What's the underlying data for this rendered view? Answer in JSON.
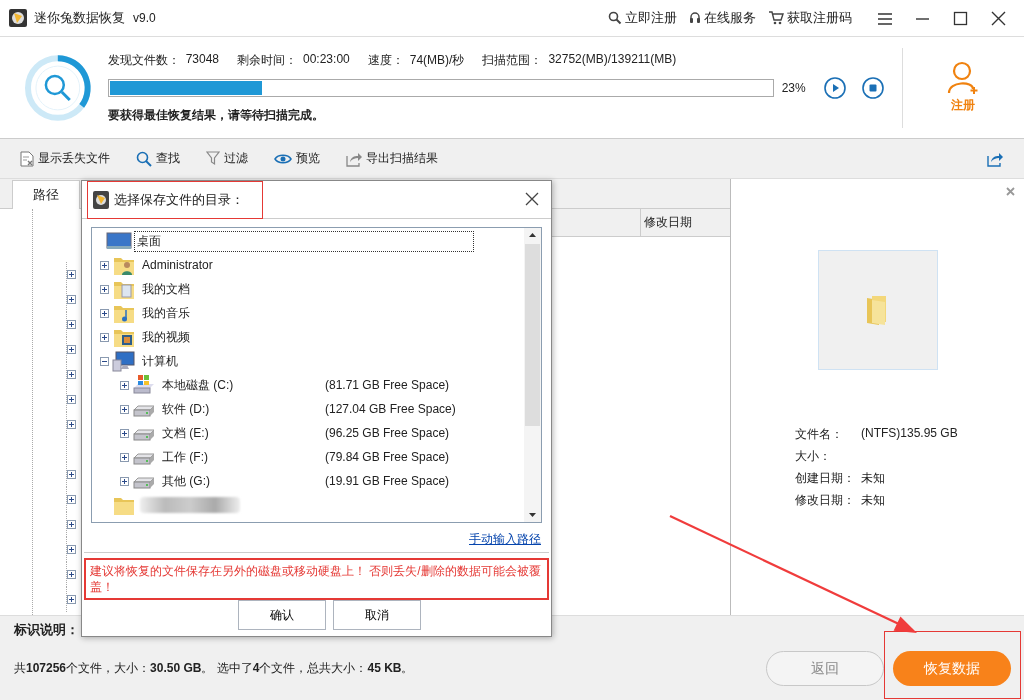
{
  "window": {
    "title": "迷你兔数据恢复",
    "version": "v9.0",
    "links": [
      {
        "kind": "register",
        "label": "立即注册"
      },
      {
        "kind": "service",
        "label": "在线服务"
      },
      {
        "kind": "cart",
        "label": "获取注册码"
      }
    ]
  },
  "scan": {
    "stats": [
      {
        "label": "发现文件数：",
        "value": "73048"
      },
      {
        "label": "剩余时间：",
        "value": "00:23:00"
      },
      {
        "label": "速度：",
        "value": "74(MB)/秒"
      },
      {
        "label": "扫描范围：",
        "value": "32752(MB)/139211(MB)"
      }
    ],
    "level": 0.23,
    "percent": "23%",
    "hint": "要获得最佳恢复结果，请等待扫描完成。",
    "register": "注册"
  },
  "toolbar": [
    {
      "kind": "lost",
      "label": "显示丢失文件"
    },
    {
      "kind": "search",
      "label": "查找"
    },
    {
      "kind": "filter",
      "label": "过滤"
    },
    {
      "kind": "preview",
      "label": "预览"
    },
    {
      "kind": "export",
      "label": "导出扫描结果"
    }
  ],
  "tabs": [
    {
      "label": "路径",
      "selected": true
    }
  ],
  "columns": [
    {
      "label": "修改日期"
    }
  ],
  "left_tree": [
    {
      "expanded": false
    },
    {
      "expanded": false
    },
    {
      "expanded": false
    },
    {
      "expanded": false
    },
    {
      "expanded": false
    },
    {
      "expanded": false
    },
    {
      "expanded": false
    },
    {
      "kind": "leaf"
    },
    {
      "expanded": false
    },
    {
      "expanded": false
    },
    {
      "expanded": false
    },
    {
      "expanded": false
    },
    {
      "expanded": false
    },
    {
      "expanded": false
    }
  ],
  "preview": {
    "fields": [
      {
        "label": "文件名：",
        "value": "(NTFS)135.95 GB"
      },
      {
        "label": "大小："
      },
      {
        "label": "创建日期：",
        "value": "未知"
      },
      {
        "label": "修改日期：",
        "value": "未知"
      }
    ]
  },
  "legend_label": "标识说明：",
  "summary": "共**107256**个文件，大小：**30.50 GB**。 选中了**4**个文件，总共大小：**45 KB**。",
  "buttons": [
    {
      "kind": "secondary",
      "label": "返回"
    },
    {
      "kind": "primary",
      "label": "恢复数据"
    }
  ],
  "dialog": {
    "title": "选择保存文件的目录：",
    "tree": [
      {
        "kind": "desktop",
        "label": "桌面",
        "selected": true,
        "children": [
          {
            "kind": "user-folder",
            "label": "Administrator",
            "selected": false,
            "expanded": false
          },
          {
            "kind": "docs-folder",
            "label": "我的文档",
            "selected": false,
            "expanded": false
          },
          {
            "kind": "music-folder",
            "label": "我的音乐",
            "selected": false,
            "expanded": false
          },
          {
            "kind": "video-folder",
            "label": "我的视频",
            "selected": false,
            "expanded": false
          },
          {
            "kind": "computer",
            "label": "计算机",
            "selected": false,
            "expanded": true,
            "children": [
              {
                "kind": "windows-drive",
                "label": "本地磁盘 (C:)",
                "free": "(81.71 GB Free Space)",
                "selected": false,
                "expanded": false
              },
              {
                "kind": "drive",
                "label": "软件 (D:)",
                "free": "(127.04 GB Free Space)",
                "selected": false,
                "expanded": false
              },
              {
                "kind": "drive",
                "label": "文档 (E:)",
                "free": "(96.25 GB Free Space)",
                "selected": false,
                "expanded": false
              },
              {
                "kind": "drive",
                "label": "工作 (F:)",
                "free": "(79.84 GB Free Space)",
                "selected": false,
                "expanded": false
              },
              {
                "kind": "drive",
                "label": "其他 (G:)",
                "free": "(19.91 GB Free Space)",
                "selected": false,
                "expanded": false
              }
            ]
          },
          {
            "kind": "blurred-folder"
          }
        ]
      }
    ],
    "link": "手动输入路径",
    "warning": "建议将恢复的文件保存在另外的磁盘或移动硬盘上！ 否则丢失/删除的数据可能会被覆盖！",
    "buttons": [
      {
        "label": "确认"
      },
      {
        "label": "取消"
      }
    ]
  }
}
